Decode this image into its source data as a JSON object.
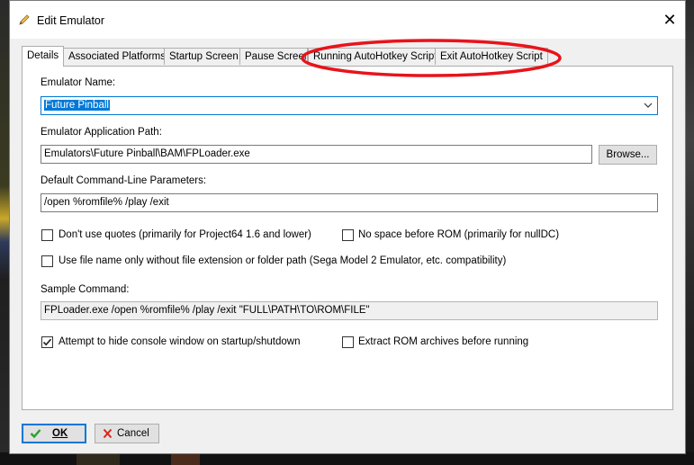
{
  "window": {
    "title": "Edit Emulator",
    "close_icon": "close-icon",
    "title_icon": "pencil-icon"
  },
  "tabs": [
    {
      "label": "Details",
      "active": true
    },
    {
      "label": "Associated Platforms"
    },
    {
      "label": "Startup Screen"
    },
    {
      "label": "Pause Screen"
    },
    {
      "label": "Running AutoHotkey Script"
    },
    {
      "label": "Exit AutoHotkey Script"
    }
  ],
  "form": {
    "emulator_name_label": "Emulator Name:",
    "emulator_name_value": "Future Pinball",
    "app_path_label": "Emulator Application Path:",
    "app_path_value": "Emulators\\Future Pinball\\BAM\\FPLoader.exe",
    "browse_label": "Browse...",
    "params_label": "Default Command-Line Parameters:",
    "params_value": "/open %romfile% /play /exit",
    "no_quotes_label": "Don't use quotes (primarily for Project64 1.6 and lower)",
    "no_space_label": "No space before ROM (primarily for nullDC)",
    "filename_only_label": "Use file name only without file extension or folder path (Sega Model 2 Emulator, etc. compatibility)",
    "sample_label": "Sample Command:",
    "sample_value": "FPLoader.exe /open %romfile% /play /exit \"FULL\\PATH\\TO\\ROM\\FILE\"",
    "hide_console_label": "Attempt to hide console window on startup/shutdown",
    "extract_label": "Extract ROM archives before running",
    "checkboxes": {
      "no_quotes": false,
      "no_space": false,
      "filename_only": false,
      "hide_console": true,
      "extract": false
    }
  },
  "footer": {
    "ok_label": "OK",
    "cancel_label": "Cancel",
    "ok_icon": "check-icon",
    "cancel_icon": "x-icon"
  },
  "colors": {
    "accent": "#0078d7",
    "annotation": "#e8131b",
    "ok_check": "#2e9e2e",
    "cancel_x": "#d9261c"
  }
}
